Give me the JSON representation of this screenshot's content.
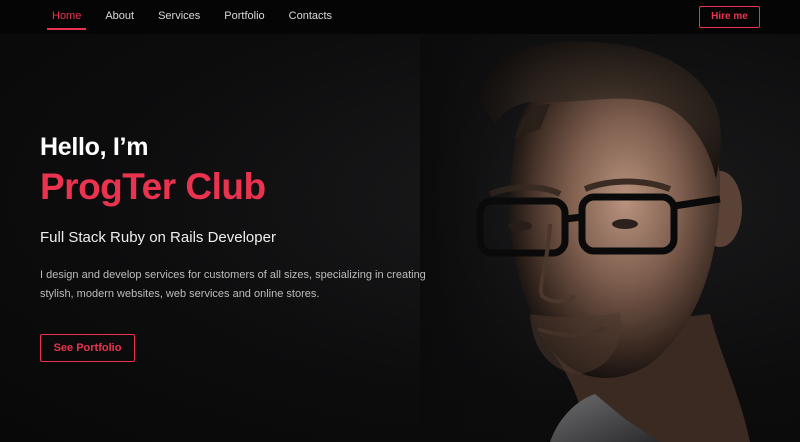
{
  "nav": {
    "items": [
      {
        "label": "Home",
        "active": true
      },
      {
        "label": "About",
        "active": false
      },
      {
        "label": "Services",
        "active": false
      },
      {
        "label": "Portfolio",
        "active": false
      },
      {
        "label": "Contacts",
        "active": false
      }
    ],
    "hire_label": "Hire me"
  },
  "hero": {
    "greeting": "Hello, I’m",
    "name": "ProgTer Club",
    "role": "Full Stack Ruby on Rails Developer",
    "description": "I design and develop services for customers of all sizes, specializing in creating stylish, modern websites, web services and online stores.",
    "cta_label": "See Portfolio"
  },
  "colors": {
    "accent": "#e9334f",
    "background": "#0b0b0c",
    "nav_background": "#050505"
  }
}
